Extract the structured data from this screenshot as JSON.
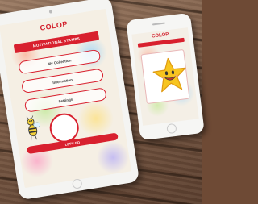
{
  "tablet": {
    "logo": "COLOP",
    "title": "MOTIVATIONAL STAMPS",
    "menu": [
      {
        "label": "My Collection"
      },
      {
        "label": "Information"
      },
      {
        "label": "Settings"
      }
    ],
    "go_label": "LET'S GO"
  },
  "phone": {
    "logo": "COLOP"
  },
  "colors": {
    "brand_red": "#d8202e",
    "star_yellow": "#f7c51f",
    "bee_yellow": "#f3d13a"
  },
  "icons": {
    "mascot": "bee-icon",
    "reward": "smiling-star-icon"
  }
}
